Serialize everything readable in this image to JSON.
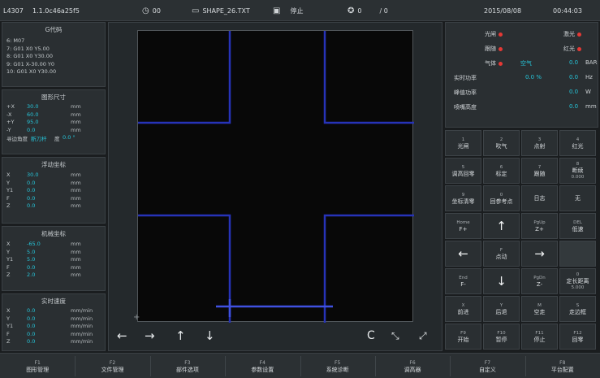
{
  "topbar": {
    "id": "L4307",
    "version": "1.1.0c46a25f5",
    "time_counter": "00",
    "file_name": "SHAPE_26.TXT",
    "run_state": "停止",
    "count_a": "0",
    "count_b": "/ 0",
    "date": "2015/08/08",
    "clock": "00:44:03"
  },
  "gcode": {
    "title": "G代码",
    "lines": [
      "6: M07",
      "7: G01 X0 Y5.00",
      "8: G01 X0 Y30.00",
      "9: G01 X-30.00 Y0",
      "10: G01 X0 Y30.00"
    ]
  },
  "shape_size": {
    "title": "图形尺寸",
    "rows": [
      {
        "k": "+X",
        "v": "30.0",
        "u": "mm"
      },
      {
        "k": "-X",
        "v": "60.0",
        "u": "mm"
      },
      {
        "k": "+Y",
        "v": "95.0",
        "u": "mm"
      },
      {
        "k": "-Y",
        "v": "0.0",
        "u": "mm"
      }
    ],
    "edge_label": "寻边角度",
    "edge_link": "断刀杆",
    "edge_unit": "度",
    "edge_value": "0.0 °"
  },
  "float_coord": {
    "title": "浮动坐标",
    "rows": [
      {
        "k": "X",
        "v": "30.0",
        "u": "mm"
      },
      {
        "k": "Y",
        "v": "0.0",
        "u": "mm"
      },
      {
        "k": "Y1",
        "v": "0.0",
        "u": "mm"
      },
      {
        "k": "F",
        "v": "0.0",
        "u": "mm"
      },
      {
        "k": "Z",
        "v": "0.0",
        "u": "mm"
      }
    ]
  },
  "machine_coord": {
    "title": "机械坐标",
    "rows": [
      {
        "k": "X",
        "v": "-65.0",
        "u": "mm"
      },
      {
        "k": "Y",
        "v": "5.0",
        "u": "mm"
      },
      {
        "k": "Y1",
        "v": "5.0",
        "u": "mm"
      },
      {
        "k": "F",
        "v": "0.0",
        "u": "mm"
      },
      {
        "k": "Z",
        "v": "2.0",
        "u": "mm"
      }
    ]
  },
  "speed": {
    "title": "实时速度",
    "rows": [
      {
        "k": "X",
        "v": "0.0",
        "u": "mm/min"
      },
      {
        "k": "Y",
        "v": "0.0",
        "u": "mm/min"
      },
      {
        "k": "Y1",
        "v": "0.0",
        "u": "mm/min"
      },
      {
        "k": "F",
        "v": "0.0",
        "u": "mm/min"
      },
      {
        "k": "Z",
        "v": "0.0",
        "u": "mm/min"
      }
    ]
  },
  "status": {
    "light_label": "光闸",
    "red_label": "激光",
    "follow_label": "跟随",
    "redlight_label": "红光",
    "gas_label": "气体",
    "gas_type": "空气",
    "gas_value": "0.0",
    "gas_unit": "BAR",
    "power_label": "实时功率",
    "power_value": "0.0 %",
    "freq_value": "0.0",
    "freq_unit": "Hz",
    "peak_label": "峰值功率",
    "peak_value": "0.0",
    "peak_unit": "W",
    "height_label": "喷嘴高度",
    "height_value": "0.0",
    "height_unit": "mm"
  },
  "keys": [
    {
      "n": "1",
      "t": "光闸"
    },
    {
      "n": "2",
      "t": "吹气"
    },
    {
      "n": "3",
      "t": "点射"
    },
    {
      "n": "4",
      "t": "红光"
    },
    {
      "n": "5",
      "t": "调高回零"
    },
    {
      "n": "6",
      "t": "标定"
    },
    {
      "n": "7",
      "t": "跟随"
    },
    {
      "n": "8",
      "t": "断续",
      "s": "0.000"
    },
    {
      "n": "9",
      "t": "坐标清零"
    },
    {
      "n": "0",
      "t": "回参考点"
    },
    {
      "n": "",
      "t": "日志"
    },
    {
      "n": "",
      "t": "无"
    },
    {
      "n": "Home",
      "t": "F+"
    },
    {
      "n": "",
      "t": "↑"
    },
    {
      "n": "PgUp",
      "t": "Z+"
    },
    {
      "n": "DEL",
      "t": "低速"
    },
    {
      "n": "",
      "t": "←"
    },
    {
      "n": "F",
      "t": "点动"
    },
    {
      "n": "",
      "t": "→"
    },
    {
      "n": "",
      "t": ""
    },
    {
      "n": "End",
      "t": "F-"
    },
    {
      "n": "",
      "t": "↓"
    },
    {
      "n": "PgDn",
      "t": "Z-"
    },
    {
      "n": "0",
      "t": "定长距离",
      "s": "5.000"
    },
    {
      "n": "X",
      "t": "前进"
    },
    {
      "n": "Y",
      "t": "后退"
    },
    {
      "n": "M",
      "t": "空走"
    },
    {
      "n": "S",
      "t": "走边框"
    },
    {
      "n": "F9",
      "t": "开始"
    },
    {
      "n": "F10",
      "t": "暂停"
    },
    {
      "n": "F11",
      "t": "停止"
    },
    {
      "n": "F12",
      "t": "回零"
    }
  ],
  "fkeys": [
    {
      "n": "F1",
      "t": "图形管理"
    },
    {
      "n": "F2",
      "t": "文件管理"
    },
    {
      "n": "F3",
      "t": "部件选项"
    },
    {
      "n": "F4",
      "t": "参数设置"
    },
    {
      "n": "F5",
      "t": "系统诊断"
    },
    {
      "n": "F6",
      "t": "调高器"
    },
    {
      "n": "F7",
      "t": "自定义"
    },
    {
      "n": "F8",
      "t": "平台配置"
    }
  ],
  "canvas_controls": {
    "left": "←",
    "right": "→",
    "up": "↑",
    "down": "↓",
    "refresh": "C",
    "zoom_in": "⤡",
    "zoom_out": "⤢"
  },
  "colors": {
    "path": "#2633b8",
    "path_highlight": "#3f51e0",
    "indicator": "#e53935",
    "value": "#26c6da"
  }
}
